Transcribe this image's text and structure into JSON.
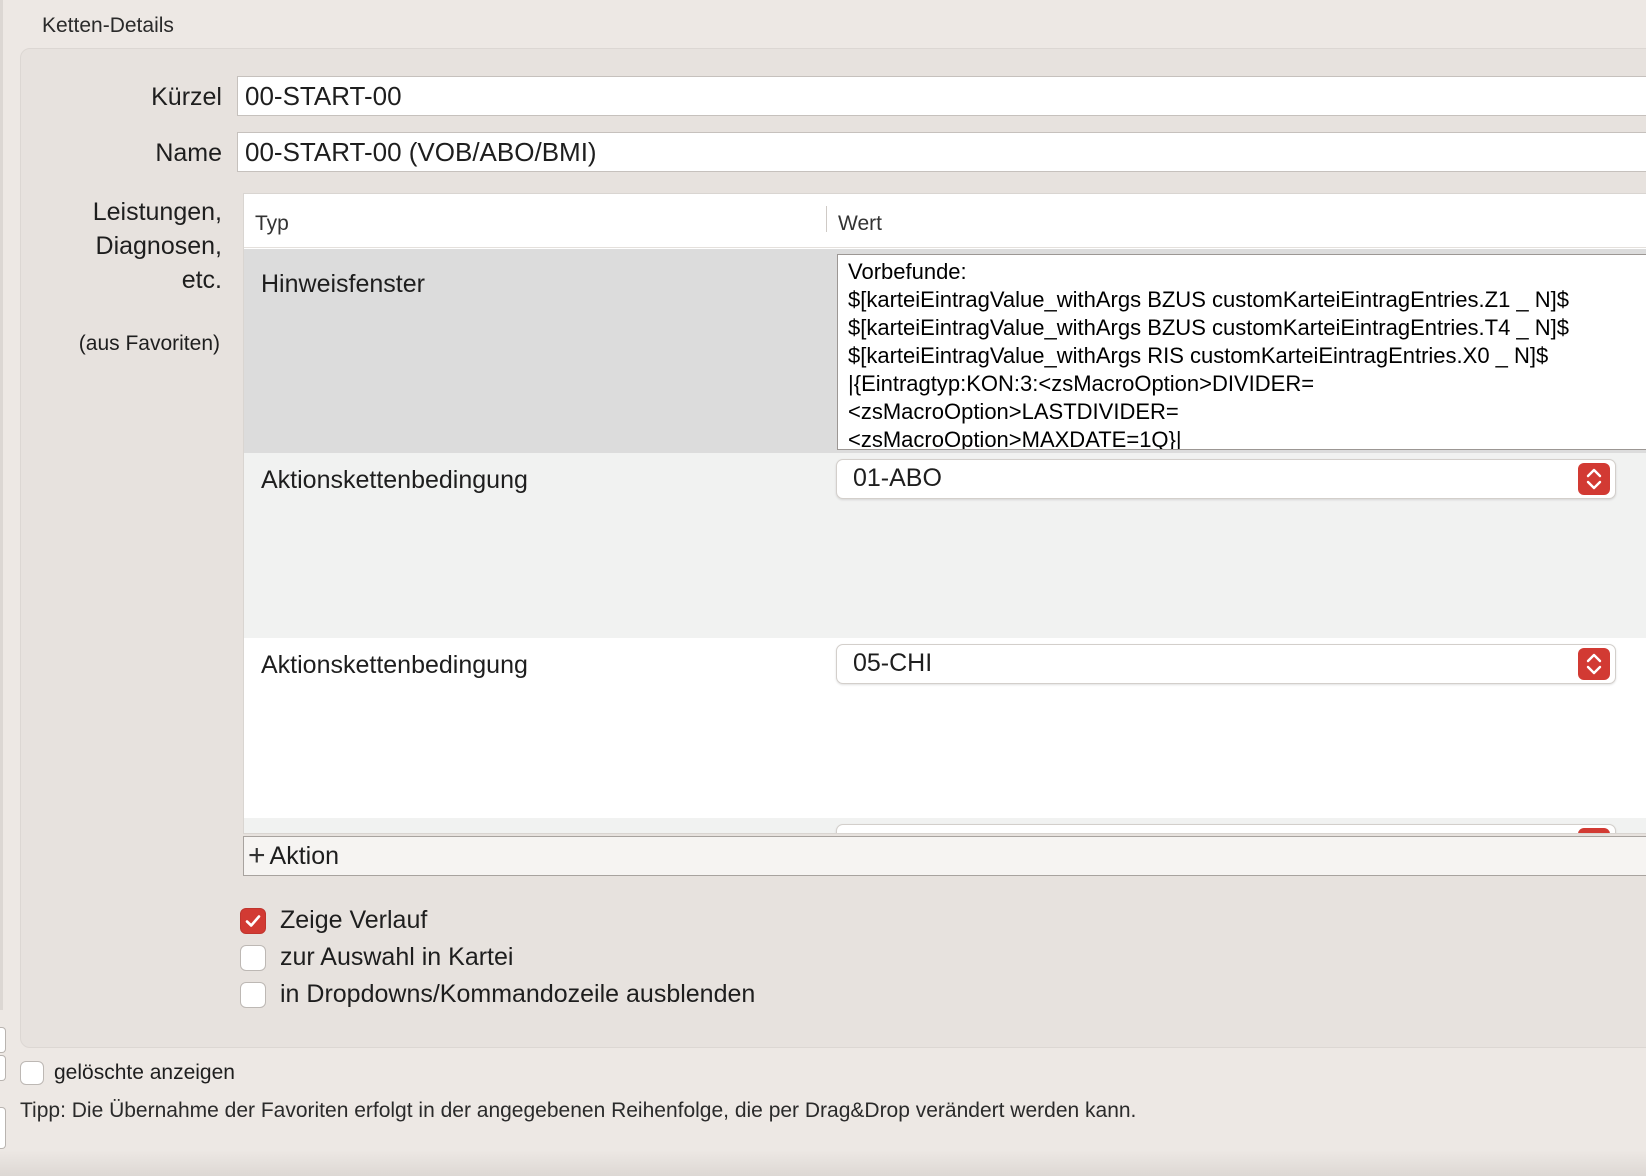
{
  "group": {
    "title": "Ketten-Details"
  },
  "form": {
    "kuerzel_label": "Kürzel",
    "kuerzel_value": "00-START-00",
    "name_label": "Name",
    "name_value": "00-START-00 (VOB/ABO/BMI)",
    "services_label_1": "Leistungen,",
    "services_label_2": "Diagnosen,",
    "services_label_3": "etc.",
    "services_note": "(aus Favoriten)"
  },
  "table": {
    "col_type": "Typ",
    "col_value": "Wert",
    "rows": [
      {
        "type": "Hinweisfenster",
        "value_lines": [
          "Vorbefunde:",
          "$[karteiEintragValue_withArgs BZUS customKarteiEintragEntries.Z1 _ N]$",
          "$[karteiEintragValue_withArgs BZUS customKarteiEintragEntries.T4 _ N]$",
          "$[karteiEintragValue_withArgs RIS customKarteiEintragEntries.X0 _ N]$",
          "|{Eintragtyp:KON:3:<zsMacroOption>DIVIDER=",
          "<zsMacroOption>LASTDIVIDER=",
          "<zsMacroOption>MAXDATE=1Q}|"
        ]
      },
      {
        "type": "Aktionskettenbedingung",
        "value": "01-ABO"
      },
      {
        "type": "Aktionskettenbedingung",
        "value": "05-CHI"
      }
    ],
    "add_label": "Aktion"
  },
  "options": [
    {
      "label": "Zeige Verlauf",
      "checked": true
    },
    {
      "label": "zur Auswahl in Kartei",
      "checked": false
    },
    {
      "label": "in Dropdowns/Kommandozeile ausblenden",
      "checked": false
    }
  ],
  "footer": {
    "show_deleted_label": "gelöschte anzeigen",
    "show_deleted_checked": false,
    "tip": "Tipp: Die Übernahme der Favoriten erfolgt in der angegebenen Reihenfolge, die per Drag&Drop verändert werden kann."
  },
  "colors": {
    "accent": "#d23a33",
    "window_bg": "#ede8e4",
    "group_bg": "#e7e2de",
    "selected_row": "#dcdcdc",
    "alt_row": "#f1f2f1"
  }
}
